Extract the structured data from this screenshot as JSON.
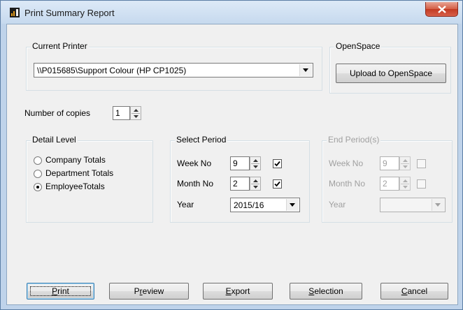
{
  "window": {
    "title": "Print Summary Report",
    "icon": "report-icon"
  },
  "current_printer": {
    "group_label": "Current Printer",
    "selected": "\\\\P015685\\Support Colour (HP CP1025)"
  },
  "openspace": {
    "group_label": "OpenSpace",
    "upload_label": "Upload to OpenSpace"
  },
  "copies": {
    "label": "Number of copies",
    "value": "1"
  },
  "detail_level": {
    "group_label": "Detail Level",
    "options": [
      {
        "label": "Company Totals",
        "selected": false
      },
      {
        "label": "Department Totals",
        "selected": false
      },
      {
        "label": "EmployeeTotals",
        "selected": true
      }
    ]
  },
  "select_period": {
    "group_label": "Select Period",
    "week_label": "Week No",
    "week_value": "9",
    "week_checked": true,
    "month_label": "Month No",
    "month_value": "2",
    "month_checked": true,
    "year_label": "Year",
    "year_value": "2015/16"
  },
  "end_period": {
    "group_label": "End Period(s)",
    "enabled": false,
    "week_label": "Week No",
    "week_value": "9",
    "week_checked": false,
    "month_label": "Month No",
    "month_value": "2",
    "month_checked": false,
    "year_label": "Year",
    "year_value": ""
  },
  "buttons": {
    "print": {
      "pre": "",
      "key": "P",
      "post": "rint"
    },
    "preview": {
      "pre": "P",
      "key": "r",
      "post": "eview"
    },
    "export": {
      "pre": "",
      "key": "E",
      "post": "xport"
    },
    "selection": {
      "pre": "",
      "key": "S",
      "post": "election"
    },
    "cancel": {
      "pre": "",
      "key": "C",
      "post": "ancel"
    }
  },
  "colors": {
    "title_bar": "#c6d9ee",
    "close_button": "#c23a22",
    "dialog_bg": "#f0f0f0"
  }
}
